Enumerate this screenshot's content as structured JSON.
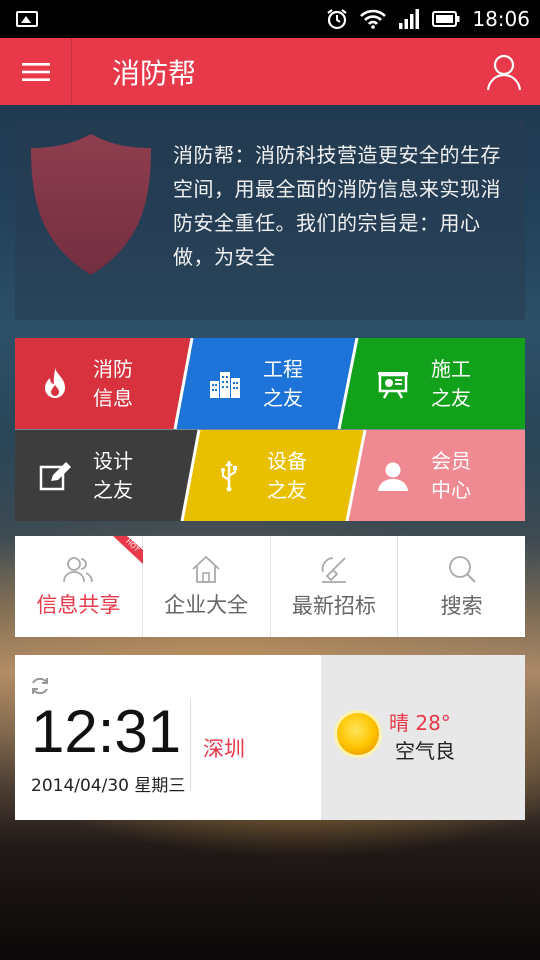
{
  "status_bar": {
    "time": "18:06"
  },
  "app": {
    "title": "消防帮"
  },
  "intro": {
    "text": "消防帮：消防科技营造更安全的生存空间，用最全面的消防信息来实现消防安全重任。我们的宗旨是：用心做，为安全"
  },
  "tiles": [
    {
      "label": "消防\n信息",
      "icon": "fire-icon",
      "color": "#d8323f"
    },
    {
      "label": "工程\n之友",
      "icon": "buildings-icon",
      "color": "#1e73d8"
    },
    {
      "label": "施工\n之友",
      "icon": "presentation-board-icon",
      "color": "#12a11b"
    },
    {
      "label": "设计\n之友",
      "icon": "pencil-edit-icon",
      "color": "#3d3d3d"
    },
    {
      "label": "设备\n之友",
      "icon": "usb-icon",
      "color": "#e9c000"
    },
    {
      "label": "会员\n中心",
      "icon": "user-icon",
      "color": "#f08a92"
    }
  ],
  "quick_nav": [
    {
      "label": "信息共享",
      "icon": "people-icon",
      "active": true,
      "badge": "HOT"
    },
    {
      "label": "企业大全",
      "icon": "house-icon",
      "active": false
    },
    {
      "label": "最新招标",
      "icon": "megaphone-icon",
      "active": false
    },
    {
      "label": "搜索",
      "icon": "search-icon",
      "active": false
    }
  ],
  "weather": {
    "time": "12:31",
    "date": "2014/04/30 星期三",
    "city": "深圳",
    "condition": "晴 28°",
    "air_quality": "空气良"
  },
  "colors": {
    "accent": "#e8394a"
  }
}
